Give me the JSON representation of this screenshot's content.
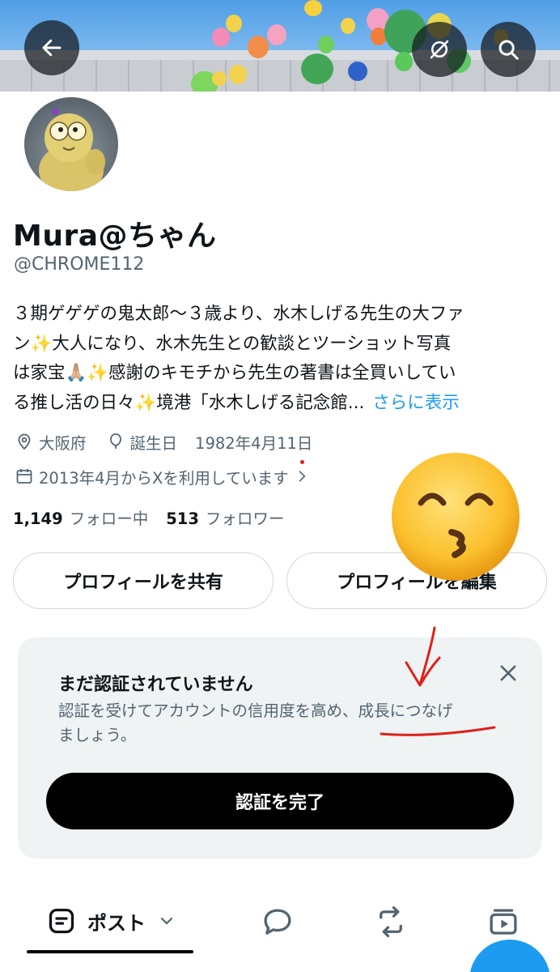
{
  "header": {
    "back_icon": "arrow-left-icon",
    "protected_icon": "slashed-circle-icon",
    "search_icon": "search-icon"
  },
  "profile": {
    "display_name": "Mura@ちゃん",
    "handle": "@CHROME112",
    "bio_lines": [
      "３期ゲゲゲの鬼太郎〜３歳より、水木しげる先生の大ファ",
      "ン✨大人になり、水木先生との歓談とツーショット写真",
      "は家宝🙏🏼✨感謝のキモチから先生の著書は全買いしてい",
      "る推し活の日々✨境港「水木しげる記念館..."
    ],
    "see_more": "さらに表示",
    "location": "大阪府",
    "birthday_label": "誕生日",
    "birthday": "1982年4月11日",
    "joined": "2013年4月からXを利用しています",
    "following_count": "1,149",
    "following_label": "フォロー中",
    "followers_count": "513",
    "followers_label": "フォロワー"
  },
  "actions": {
    "share_profile": "プロフィールを共有",
    "edit_profile": "プロフィールを編集"
  },
  "verify": {
    "title": "まだ認証されていません",
    "description_lines": [
      "認証を受けてアカウントの信用度を高め、成長につなげ",
      "ましょう。"
    ],
    "button": "認証を完了"
  },
  "tabs": {
    "posts": "ポスト"
  },
  "colors": {
    "accent": "#1d9bf0",
    "secondary_text": "#536471",
    "card_bg": "#eff3f4",
    "annotation": "#e0201a"
  }
}
